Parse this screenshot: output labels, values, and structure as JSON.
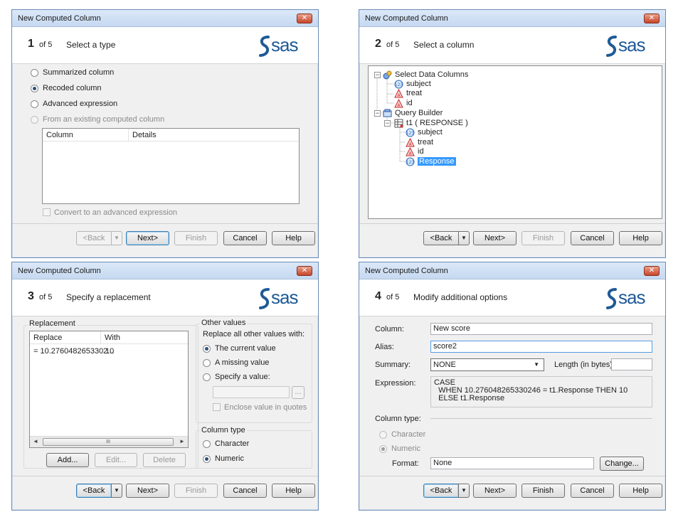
{
  "window_title": "New Computed Column",
  "logo_text": "sas",
  "close_glyph": "✕",
  "buttons": {
    "back": "<Back",
    "next": "Next>",
    "finish": "Finish",
    "cancel": "Cancel",
    "help": "Help",
    "dropdown_arrow": "▼"
  },
  "step1": {
    "number": "1",
    "of": "of 5",
    "title": "Select a type",
    "options": [
      "Summarized column",
      "Recoded column",
      "Advanced expression",
      "From an existing computed column"
    ],
    "selected_option": "Recoded column",
    "table_headers": [
      "Column",
      "Details"
    ],
    "convert_label": "Convert to an advanced expression"
  },
  "step2": {
    "number": "2",
    "of": "of 5",
    "title": "Select a column",
    "tree": {
      "root1": "Select Data Columns",
      "root1_children": [
        "subject",
        "treat",
        "id"
      ],
      "root2": "Query Builder",
      "table": "t1 ( RESPONSE )",
      "table_children": [
        "subject",
        "treat",
        "id",
        "Response"
      ],
      "selected": "Response"
    }
  },
  "step3": {
    "number": "3",
    "of": "of 5",
    "title": "Specify a replacement",
    "replacement_group": "Replacement",
    "table_headers": [
      "Replace",
      "With"
    ],
    "rows": [
      {
        "replace": "= 10.2760482653302...",
        "with": "10"
      }
    ],
    "scroll_thumb": "III",
    "add_button": "Add...",
    "edit_button": "Edit...",
    "delete_button": "Delete",
    "other_values_group": "Other values",
    "replace_all_label": "Replace all other values with:",
    "other_options": [
      "The current value",
      "A missing value",
      "Specify a value:"
    ],
    "other_selected": "The current value",
    "browse_button": "...",
    "enclose_label": "Enclose value in quotes",
    "column_type_group": "Column type",
    "type_options": [
      "Character",
      "Numeric"
    ],
    "type_selected": "Numeric"
  },
  "step4": {
    "number": "4",
    "of": "of 5",
    "title": "Modify additional options",
    "column_label": "Column:",
    "column_value": "New score",
    "alias_label": "Alias:",
    "alias_value": "score2",
    "summary_label": "Summary:",
    "summary_value": "NONE",
    "length_label": "Length (in bytes):",
    "length_value": "",
    "expression_label": "Expression:",
    "expression_lines": [
      "CASE",
      "  WHEN 10.276048265330246 = t1.Response THEN 10",
      "  ELSE t1.Response"
    ],
    "column_type_label": "Column type:",
    "type_options": [
      "Character",
      "Numeric"
    ],
    "type_selected": "Numeric",
    "format_label": "Format:",
    "format_value": "None",
    "change_button": "Change..."
  },
  "colors": {
    "accent": "#3399ff",
    "logo": "#1e5a96",
    "title_bar": "#c6d9f1",
    "close": "#c8452a"
  }
}
